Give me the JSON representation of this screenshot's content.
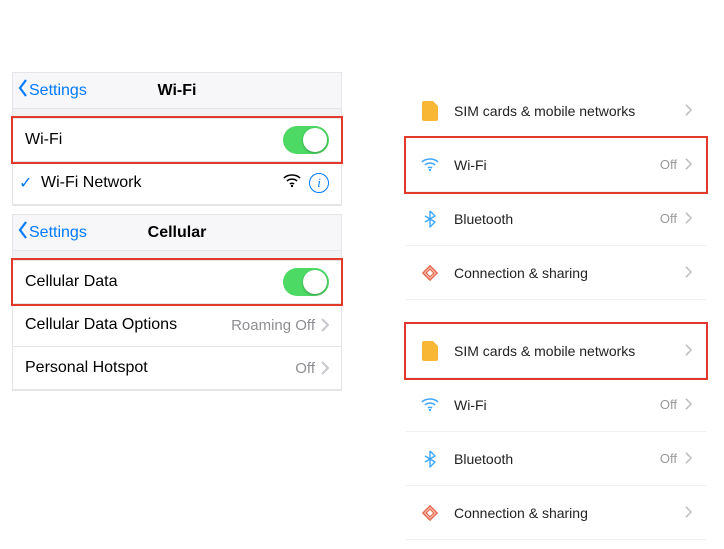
{
  "ios_wifi": {
    "back_label": "Settings",
    "title": "Wi-Fi",
    "toggle_row_label": "Wi-Fi",
    "network_row_label": "Wi-Fi Network"
  },
  "ios_cell": {
    "back_label": "Settings",
    "title": "Cellular",
    "toggle_row_label": "Cellular Data",
    "options_row_label": "Cellular Data Options",
    "options_row_value": "Roaming Off",
    "hotspot_row_label": "Personal Hotspot",
    "hotspot_row_value": "Off"
  },
  "android_top": {
    "rows": [
      {
        "label": "SIM cards & mobile networks",
        "value": ""
      },
      {
        "label": "Wi-Fi",
        "value": "Off"
      },
      {
        "label": "Bluetooth",
        "value": "Off"
      },
      {
        "label": "Connection & sharing",
        "value": ""
      }
    ]
  },
  "android_bot": {
    "rows": [
      {
        "label": "SIM cards & mobile networks",
        "value": ""
      },
      {
        "label": "Wi-Fi",
        "value": "Off"
      },
      {
        "label": "Bluetooth",
        "value": "Off"
      },
      {
        "label": "Connection & sharing",
        "value": ""
      }
    ]
  }
}
